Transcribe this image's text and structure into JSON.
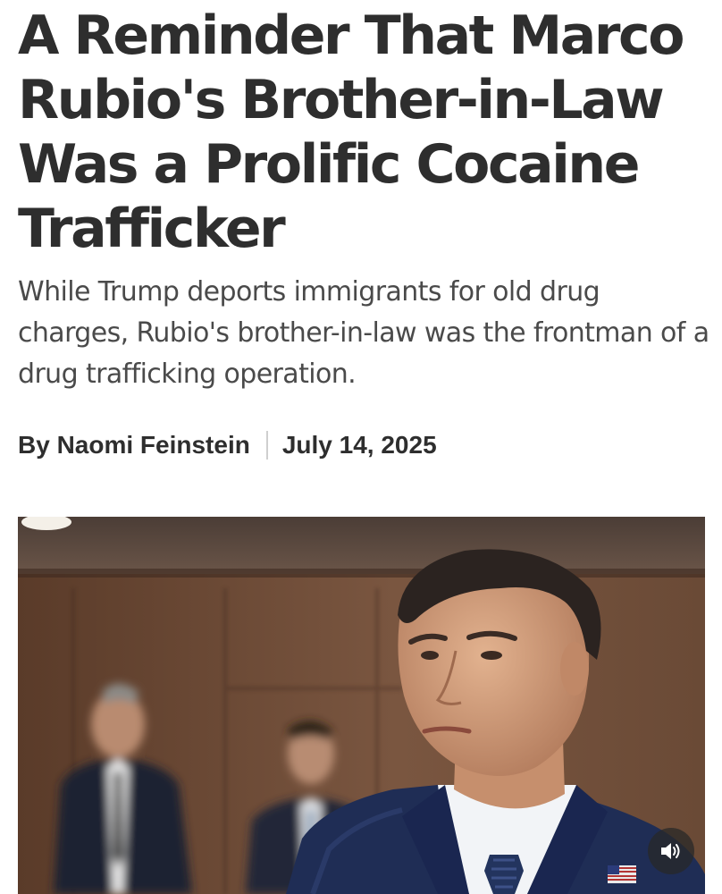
{
  "article": {
    "headline": "A Reminder That Marco Rubio's Brother-in-Law Was a Prolific Cocaine Trafficker",
    "dek": "While Trump deports immigrants for old drug charges, Rubio's brother-in-law was the frontman of a drug trafficking operation.",
    "byline": {
      "author": "By Naomi Feinstein",
      "date": "July 14, 2025"
    }
  },
  "media": {
    "audio_icon": "speaker-volume-icon",
    "pin_icon": "us-flag-pin-icon"
  },
  "colors": {
    "headline": "#2e2e2e",
    "dek": "#4a4a4a",
    "divider": "#cfcfcf",
    "suit": "#1f2d55",
    "wall": "#6b4a35"
  }
}
